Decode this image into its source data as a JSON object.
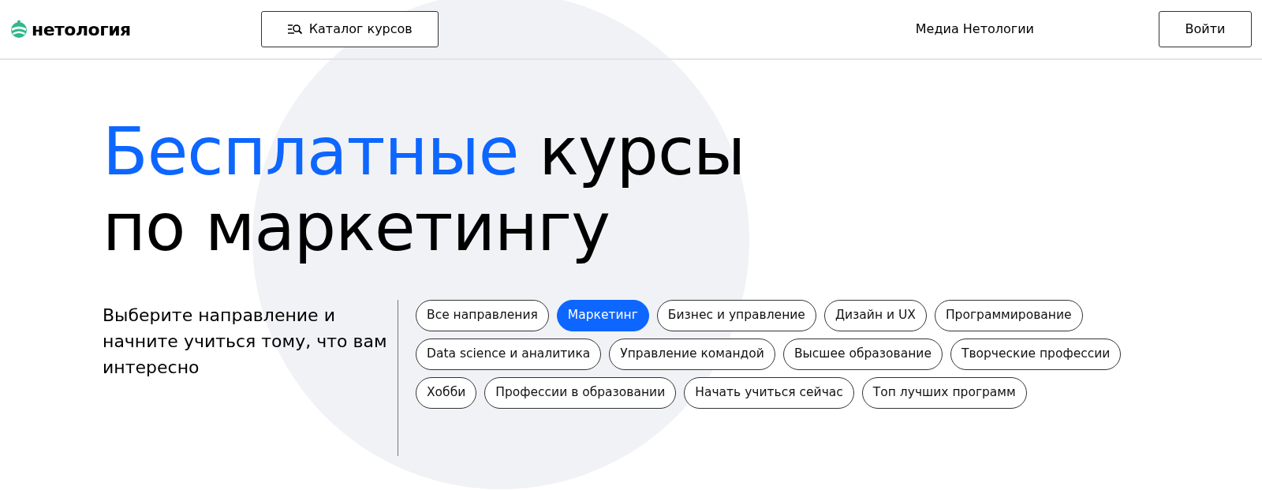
{
  "header": {
    "logo": "нетология",
    "catalog_button": "Каталог курсов",
    "media_link": "Медиа Нетологии",
    "login_button": "Войти"
  },
  "hero": {
    "title_accent": "Бесплатные",
    "title_rest": "курсы по маркетингу",
    "subtitle": "Выберите направление и начните учиться тому, что вам интересно"
  },
  "chips": [
    {
      "label": "Все направления",
      "selected": false
    },
    {
      "label": "Маркетинг",
      "selected": true
    },
    {
      "label": "Бизнес и управление",
      "selected": false
    },
    {
      "label": "Дизайн и UX",
      "selected": false
    },
    {
      "label": "Программирование",
      "selected": false
    },
    {
      "label": "Data science и аналитика",
      "selected": false
    },
    {
      "label": "Управление командой",
      "selected": false
    },
    {
      "label": "Высшее образование",
      "selected": false
    },
    {
      "label": "Творческие профессии",
      "selected": false
    },
    {
      "label": "Хобби",
      "selected": false
    },
    {
      "label": "Профессии в образовании",
      "selected": false
    },
    {
      "label": "Начать учиться сейчас",
      "selected": false
    },
    {
      "label": "Топ лучших программ",
      "selected": false
    }
  ]
}
